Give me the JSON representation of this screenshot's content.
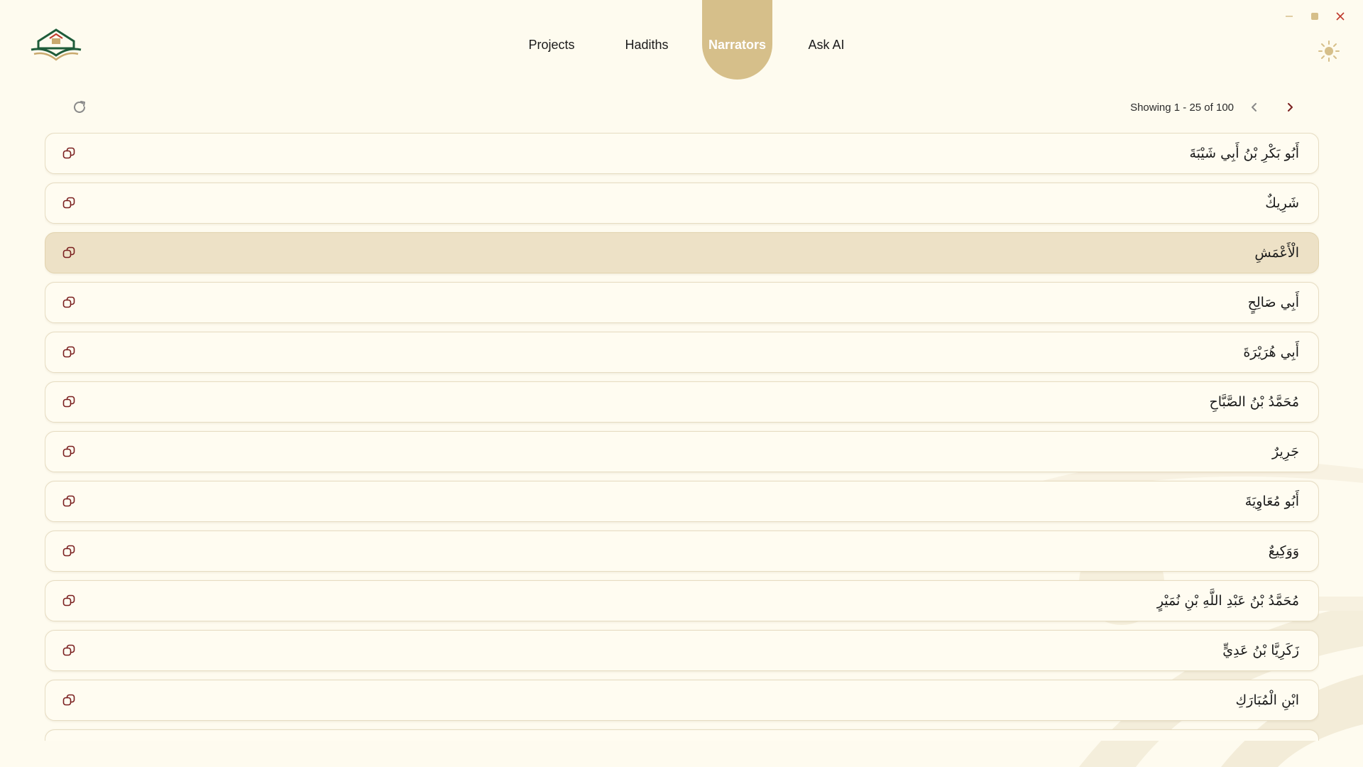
{
  "window": {
    "controls": [
      "minimize-icon",
      "maximize-icon",
      "close-icon"
    ]
  },
  "header": {
    "logo_icon": "book-mosque-logo",
    "nav": [
      {
        "label": "Projects"
      },
      {
        "label": "Hadiths"
      },
      {
        "label": "Narrators",
        "active": true
      },
      {
        "label": "Ask AI"
      }
    ],
    "theme_icon": "sun-icon"
  },
  "toolbar": {
    "refresh_icon": "refresh-icon",
    "showing_text": "Showing 1 - 25 of 100",
    "prev_icon": "chevron-left-icon",
    "next_icon": "chevron-right-icon"
  },
  "narrators": [
    {
      "name": "أَبُو بَكْرِ بْنُ أَبِي شَيْبَةَ"
    },
    {
      "name": "شَرِيكٌ"
    },
    {
      "name": "الْأَعْمَشِ",
      "selected": true
    },
    {
      "name": "أَبِي صَالِحٍ"
    },
    {
      "name": "أَبِي هُرَيْرَةَ"
    },
    {
      "name": "مُحَمَّدُ بْنُ الصَّبَّاحِ"
    },
    {
      "name": "جَرِيرٌ"
    },
    {
      "name": "أَبُو مُعَاوِيَةَ"
    },
    {
      "name": "وَوَكِيعٌ"
    },
    {
      "name": "مُحَمَّدُ بْنُ عَبْدِ اللَّهِ بْنِ نُمَيْرٍ"
    },
    {
      "name": "زَكَرِيَّا بْنُ عَدِيٍّ"
    },
    {
      "name": "ابْنِ الْمُبَارَكِ"
    },
    {
      "name": ""
    }
  ],
  "colors": {
    "background": "#fefbef",
    "accent": "#d6bf8a",
    "selected_row": "#ede1c6",
    "brand_green": "#1f5c3a",
    "close_red": "#c0392b"
  }
}
